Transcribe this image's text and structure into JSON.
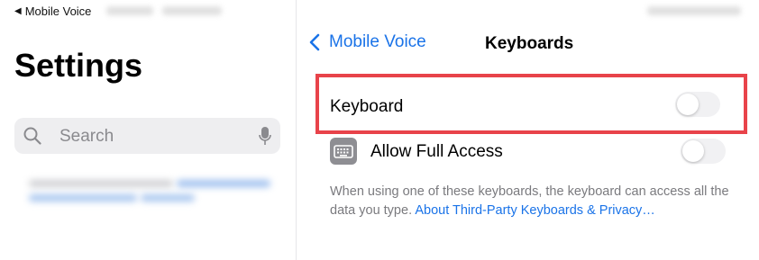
{
  "status_bar": {
    "back_app_label": "Mobile Voice"
  },
  "sidebar": {
    "title": "Settings",
    "search": {
      "placeholder": "Search"
    }
  },
  "nav": {
    "back_label": "Mobile Voice",
    "title": "Keyboards"
  },
  "rows": {
    "keyboard": {
      "label": "Keyboard",
      "toggle_on": false
    },
    "full_access": {
      "label": "Allow Full Access",
      "toggle_on": false
    }
  },
  "footer": {
    "text": "When using one of these keyboards, the keyboard can access all the data you type. ",
    "link": "About Third-Party Keyboards & Privacy…"
  },
  "colors": {
    "accent": "#1a73e8",
    "highlight_border": "#e8434a",
    "toggle_off": "#f1f1f3"
  },
  "icons": [
    "back-triangle-icon",
    "search-icon",
    "microphone-icon",
    "chevron-left-icon",
    "keyboard-icon"
  ]
}
